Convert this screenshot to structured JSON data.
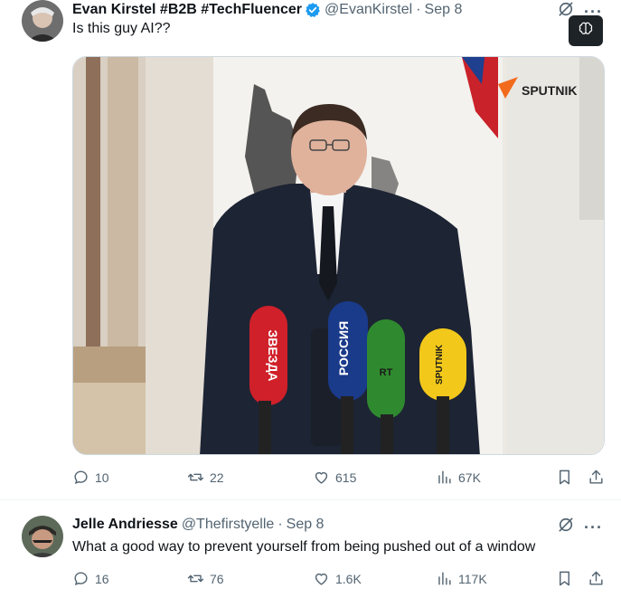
{
  "tweets": [
    {
      "author": "Evan Kirstel #B2B #TechFluencer",
      "handle": "@EvanKirstel",
      "separator": "·",
      "time": "Sep 8",
      "text": "Is this guy AI??",
      "verified": true,
      "image_watermark": "SPUTNIK",
      "mic_labels": [
        "ЗВЕЗДА",
        "РОССИЯ",
        "RT",
        "SPUTNIK"
      ],
      "stats": {
        "replies": "10",
        "retweets": "22",
        "likes": "615",
        "views": "67K"
      }
    },
    {
      "author": "Jelle Andriesse",
      "handle": "@Thefirstyelle",
      "separator": "·",
      "time": "Sep 8",
      "text": "What a good way to prevent yourself from being pushed out of a window",
      "verified": false,
      "stats": {
        "replies": "16",
        "retweets": "76",
        "likes": "1.6K",
        "views": "117K"
      }
    }
  ],
  "colors": {
    "text": "#0f1419",
    "secondary": "#536471",
    "verified_blue": "#1d9bf0",
    "sputnik_orange": "#f26b1d",
    "mic_red": "#d0202a",
    "mic_blue": "#1a3a8a",
    "mic_green": "#2f8a2f",
    "mic_yellow": "#f2c81a"
  },
  "icons": [
    "reply-icon",
    "retweet-icon",
    "like-icon",
    "views-icon",
    "bookmark-icon",
    "share-icon",
    "grok-icon",
    "more-icon",
    "verified-icon"
  ]
}
